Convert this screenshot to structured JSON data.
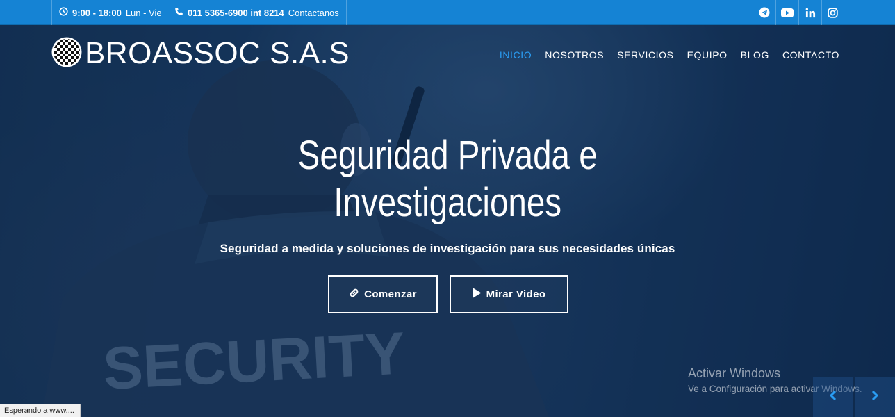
{
  "topbar": {
    "hours": "9:00 - 18:00",
    "days": "Lun - Vie",
    "phone": "011 5365-6900 int 8214",
    "contact": "Contactanos",
    "socials": [
      "telegram-icon",
      "youtube-icon",
      "linkedin-icon",
      "instagram-icon"
    ]
  },
  "header": {
    "brand": "BROASSOC S.A.S",
    "nav": [
      {
        "label": "INICIO",
        "active": true
      },
      {
        "label": "NOSOTROS"
      },
      {
        "label": "SERVICIOS"
      },
      {
        "label": "EQUIPO"
      },
      {
        "label": "BLOG"
      },
      {
        "label": "CONTACTO"
      }
    ]
  },
  "hero": {
    "title_line1": "Seguridad Privada e",
    "title_line2": "Investigaciones",
    "subtitle": "Seguridad a medida y soluciones de investigación para sus necesidades únicas",
    "primary_button": "Comenzar",
    "secondary_button": "Mirar Video",
    "background_text": "SECURITY"
  },
  "watermark": {
    "title": "Activar Windows",
    "subtitle": "Ve a Configuración para activar Windows."
  },
  "status_bar": "Esperando a www....",
  "colors": {
    "topbar": "#1583d4",
    "accent": "#2a9df4",
    "hero_overlay": "#0e2c54"
  }
}
